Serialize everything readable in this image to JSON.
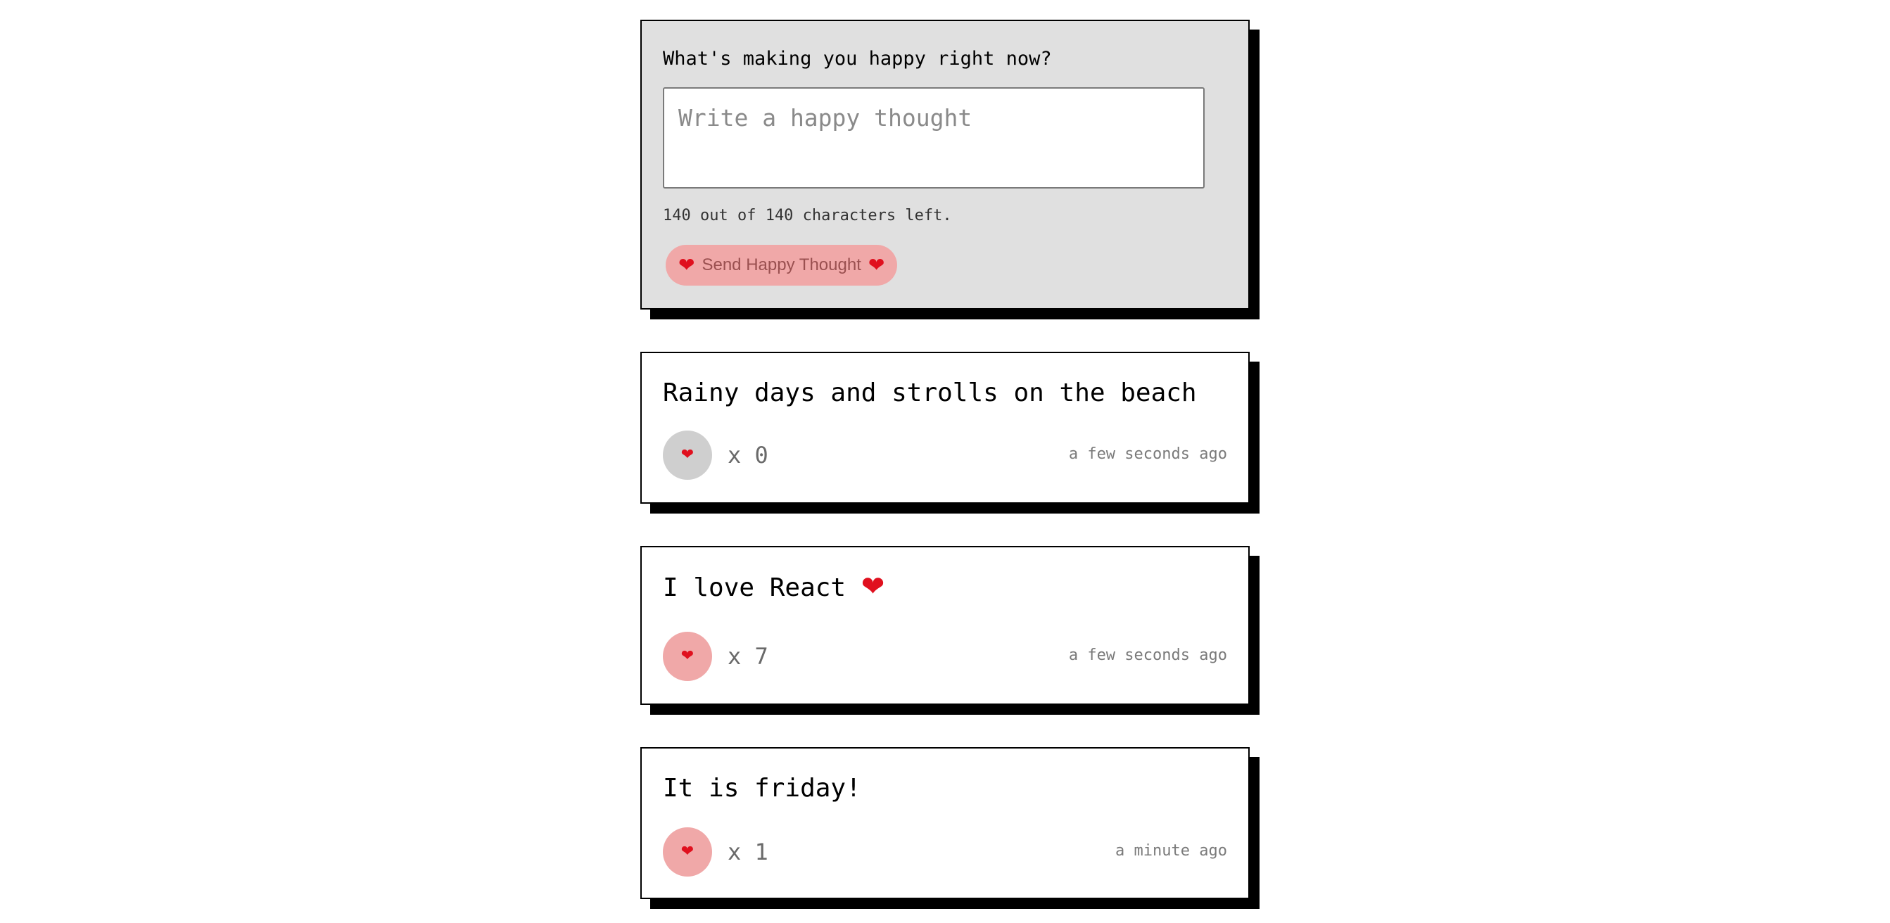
{
  "form": {
    "title": "What's making you happy right now?",
    "input_placeholder": "Write a happy thought",
    "input_value": "",
    "char_count_text": "140 out of 140 characters left.",
    "send_label": "Send Happy Thought",
    "send_icon": "heart-icon"
  },
  "thoughts": [
    {
      "message": "Rainy days and strolls on the beach",
      "message_icon": "",
      "likes_text": "x 0",
      "likes": 0,
      "liked": false,
      "time": "a few seconds ago"
    },
    {
      "message": "I love React",
      "message_icon": "heart-icon",
      "likes_text": "x 7",
      "likes": 7,
      "liked": true,
      "time": "a few seconds ago"
    },
    {
      "message": "It is friday!",
      "message_icon": "",
      "likes_text": "x 1",
      "likes": 1,
      "liked": true,
      "time": "a minute ago"
    }
  ],
  "colors": {
    "form_background": "#e0e0e0",
    "card_border": "#000000",
    "shadow": "#000000",
    "button_pink": "#f0a8a8",
    "button_grey": "#cfcfcf",
    "heart": "#e0101e"
  }
}
